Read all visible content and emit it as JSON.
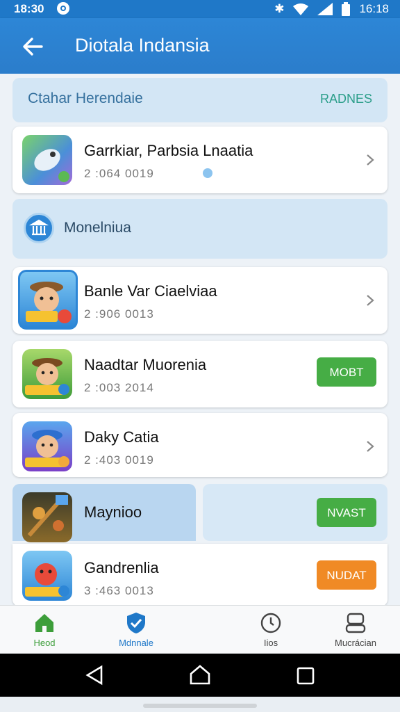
{
  "status": {
    "time": "18:30",
    "time_right": "16:18"
  },
  "appbar": {
    "title": "Diotala Indansia"
  },
  "banner": {
    "left_text": "Ctahar Herendaie",
    "right_text": "RADNES"
  },
  "section": {
    "label": "Monelniua"
  },
  "items": [
    {
      "name": "Garrkiar, Parbsia Lnaatia",
      "sub": "2 :064 0019"
    },
    {
      "name": "Banle Var Ciaelviaa",
      "sub": "2 :906 0013"
    },
    {
      "name": "Naadtar Muorenia",
      "sub": "2 :003 2014",
      "button": "MOBT"
    },
    {
      "name": "Daky Catia",
      "sub": "2 :403 0019"
    },
    {
      "name": "Maynioo",
      "button": "NVAST"
    },
    {
      "name": "Gandrenlia",
      "sub": "3 :463 0013",
      "button": "NUDAT"
    }
  ],
  "nav": [
    {
      "label": "Heod"
    },
    {
      "label": "Mdnnale"
    },
    {
      "label": "Iios"
    },
    {
      "label": "Mucrácian"
    }
  ],
  "colors": {
    "primary": "#2b7dcb",
    "green": "#46ad45",
    "orange": "#f08a25",
    "nav_active": "#1f78c8"
  }
}
